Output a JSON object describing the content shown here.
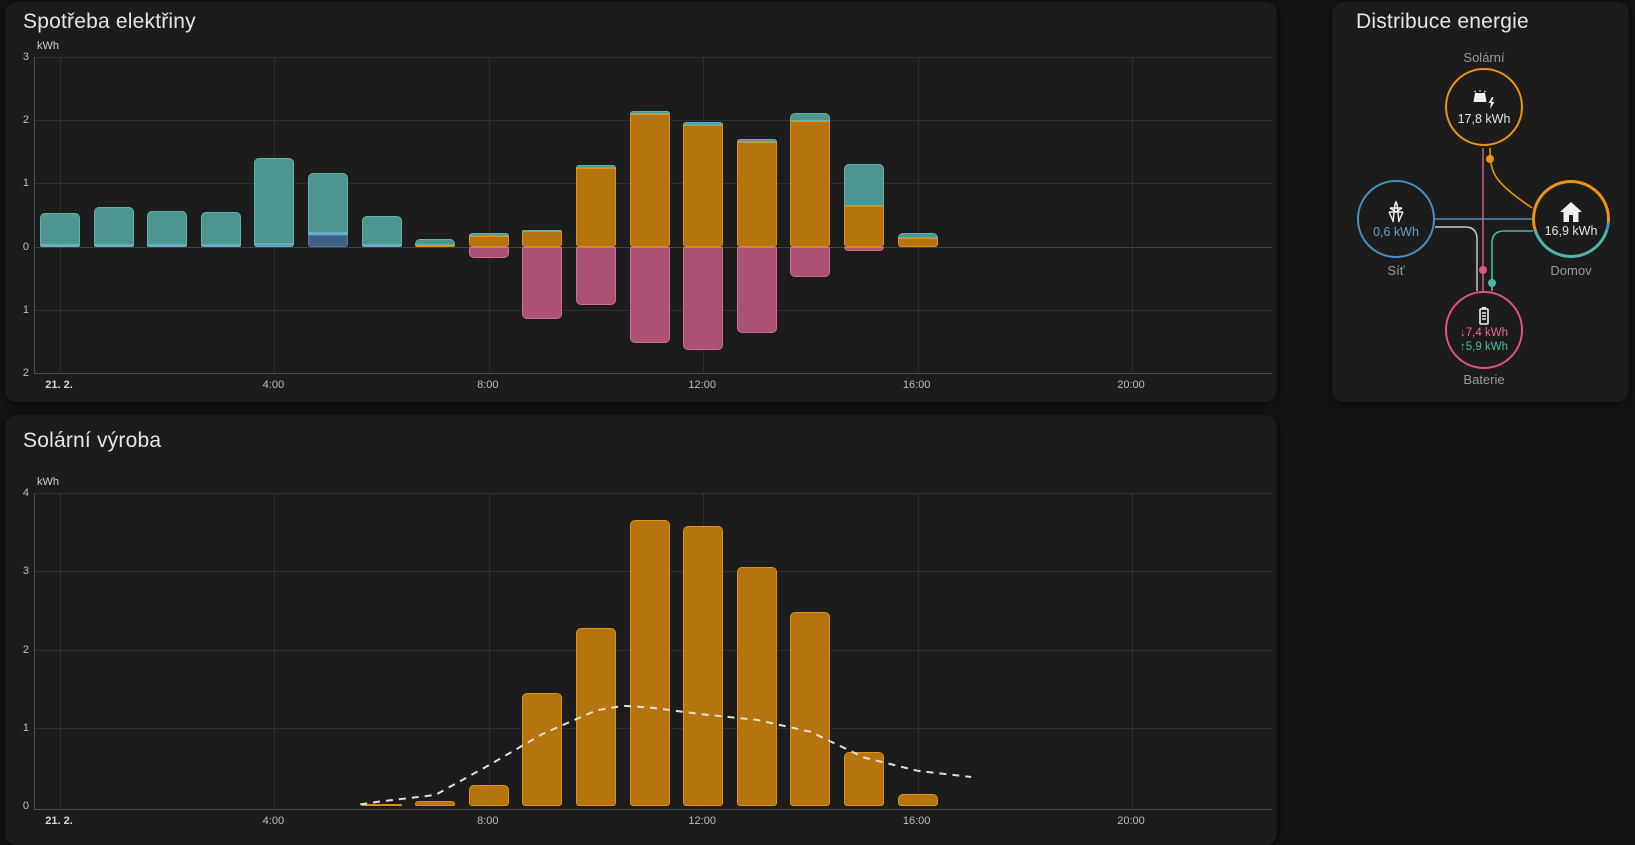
{
  "cards": {
    "consumption": {
      "title": "Spotřeba elektřiny",
      "unit": "kWh"
    },
    "solar_production": {
      "title": "Solární výroba",
      "unit": "kWh"
    },
    "distribution": {
      "title": "Distribuce energie",
      "nodes": {
        "solar": {
          "label": "Solární",
          "value": "17,8 kWh"
        },
        "grid": {
          "label": "Síť",
          "value": "0,6 kWh"
        },
        "home": {
          "label": "Domov",
          "value": "16,9 kWh"
        },
        "battery": {
          "label": "Baterie",
          "value_in": "↓7,4 kWh",
          "value_out": "↑5,9 kWh"
        }
      }
    }
  },
  "colors": {
    "solar_fill": "#b5740e",
    "solar_border": "#dc930f",
    "battery_out_fill": "#4d968f",
    "battery_out_border": "#62b4ab",
    "battery_in_fill": "#ac5176",
    "battery_in_border": "#cf6d95",
    "grid_fill": "#4f94c4",
    "grid_border": "#6aaad3",
    "grid2_fill": "#3c6086",
    "grid2_border": "#4f7aa6",
    "forecast_line": "#e3e0db",
    "node_solar": "#eb9410",
    "node_grid": "#488fc2",
    "node_battery": "#e0547f",
    "node_home_teal": "#4db6ac",
    "flow_gray": "#cfcfcf",
    "flow_pink": "#c85a78",
    "value_grid_text": "#64a1ce",
    "value_batt_in": "#ed6a92",
    "value_batt_out": "#4db6ac"
  },
  "chart_data": [
    {
      "type": "bar",
      "title": "Spotřeba elektřiny",
      "ylabel": "kWh",
      "ylim": [
        -2,
        3
      ],
      "stacked": true,
      "x_hours": [
        0,
        1,
        2,
        3,
        4,
        5,
        6,
        7,
        8,
        9,
        10,
        11,
        12,
        13,
        14,
        15,
        16
      ],
      "series": [
        {
          "name": "grid2",
          "values": [
            0,
            0,
            0,
            0,
            0,
            0.19,
            0,
            0,
            0,
            0,
            0,
            0,
            0,
            0,
            0,
            0,
            0
          ]
        },
        {
          "name": "grid",
          "values": [
            0.03,
            0.03,
            0.03,
            0.03,
            0.04,
            0.03,
            0.03,
            0,
            0,
            0,
            0,
            0,
            0,
            0,
            0,
            0,
            0
          ]
        },
        {
          "name": "solar",
          "values": [
            0,
            0,
            0,
            0,
            0,
            0,
            0,
            0.03,
            0.16,
            0.24,
            1.24,
            2.1,
            1.93,
            1.66,
            1.98,
            0.64,
            0.14
          ]
        },
        {
          "name": "battery_out",
          "values": [
            0.5,
            0.6,
            0.53,
            0.51,
            1.36,
            0.95,
            0.45,
            0.09,
            0.05,
            0.03,
            0.05,
            0.05,
            0.04,
            0.04,
            0.13,
            0.66,
            0.08
          ]
        },
        {
          "name": "battery_in",
          "values": [
            0,
            0,
            0,
            0,
            0,
            0,
            0,
            0,
            -0.18,
            -1.15,
            -0.92,
            -1.52,
            -1.63,
            -1.37,
            -0.48,
            -0.07,
            0
          ]
        }
      ],
      "y_ticks": [
        {
          "v": 3,
          "label": "3"
        },
        {
          "v": 2,
          "label": "2"
        },
        {
          "v": 1,
          "label": "1"
        },
        {
          "v": 0,
          "label": "0"
        },
        {
          "v": -1,
          "label": "1"
        },
        {
          "v": -2,
          "label": "2"
        }
      ],
      "x_ticks": [
        {
          "h": 0,
          "label": "21. 2."
        },
        {
          "h": 4,
          "label": "4:00"
        },
        {
          "h": 8,
          "label": "8:00"
        },
        {
          "h": 12,
          "label": "12:00"
        },
        {
          "h": 16,
          "label": "16:00"
        },
        {
          "h": 20,
          "label": "20:00"
        }
      ]
    },
    {
      "type": "bar",
      "title": "Solární výroba",
      "ylabel": "kWh",
      "ylim": [
        0,
        4
      ],
      "x_hours": [
        6,
        7,
        8,
        9,
        10,
        11,
        12,
        13,
        14,
        15,
        16
      ],
      "series": [
        {
          "name": "solar",
          "values": [
            0.02,
            0.06,
            0.27,
            1.45,
            2.27,
            3.65,
            3.58,
            3.05,
            2.48,
            0.69,
            0.15
          ]
        }
      ],
      "forecast_line": [
        [
          5.6,
          0.02
        ],
        [
          6,
          0.06
        ],
        [
          7,
          0.14
        ],
        [
          8,
          0.52
        ],
        [
          9,
          0.92
        ],
        [
          10,
          1.22
        ],
        [
          10.5,
          1.28
        ],
        [
          11,
          1.26
        ],
        [
          12,
          1.17
        ],
        [
          13,
          1.1
        ],
        [
          14,
          0.95
        ],
        [
          15,
          0.62
        ],
        [
          16,
          0.45
        ],
        [
          17,
          0.37
        ]
      ],
      "y_ticks": [
        {
          "v": 4,
          "label": "4"
        },
        {
          "v": 3,
          "label": "3"
        },
        {
          "v": 2,
          "label": "2"
        },
        {
          "v": 1,
          "label": "1"
        },
        {
          "v": 0,
          "label": "0"
        }
      ],
      "x_ticks": [
        {
          "h": 0,
          "label": "21. 2."
        },
        {
          "h": 4,
          "label": "4:00"
        },
        {
          "h": 8,
          "label": "8:00"
        },
        {
          "h": 12,
          "label": "12:00"
        },
        {
          "h": 16,
          "label": "16:00"
        },
        {
          "h": 20,
          "label": "20:00"
        }
      ]
    }
  ],
  "distribution_flows": {
    "home_ring": {
      "solar_deg": [
        0,
        95
      ],
      "grid_deg": [
        95,
        108
      ],
      "battery_deg": [
        108,
        252
      ]
    }
  }
}
